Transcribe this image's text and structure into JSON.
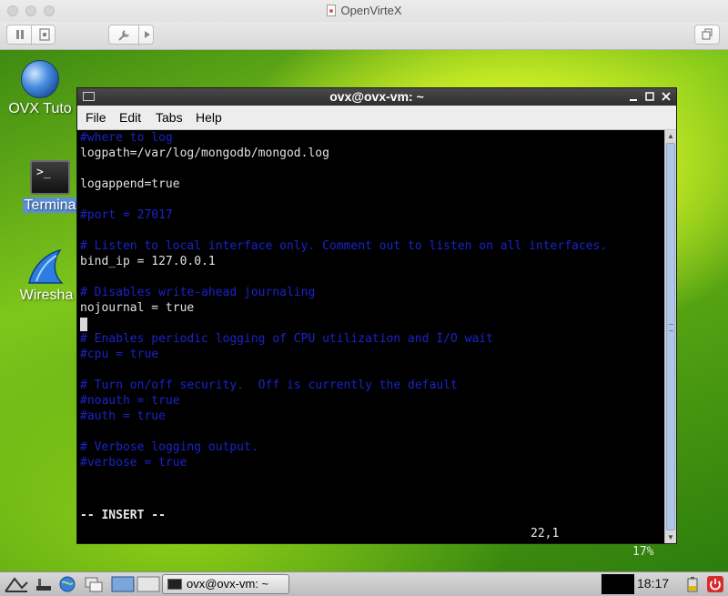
{
  "host_window": {
    "title": "OpenVirteX",
    "toolbar": {
      "buttons": [
        "pause-icon",
        "snapshot-icon",
        "wrench-icon",
        "play-icon",
        "window-icon"
      ]
    }
  },
  "desktop": {
    "icons": [
      {
        "label": "OVX Tuto",
        "icon": "globe-icon",
        "selected": false
      },
      {
        "label": "Termina",
        "icon": "terminal-icon",
        "selected": true
      },
      {
        "label": "Wiresha",
        "icon": "wireshark-icon",
        "selected": false
      }
    ]
  },
  "terminal": {
    "title": "ovx@ovx-vm: ~",
    "menu": [
      "File",
      "Edit",
      "Tabs",
      "Help"
    ],
    "lines": [
      {
        "text": "#where to log",
        "type": "comment"
      },
      {
        "text": "logpath=/var/log/mongodb/mongod.log",
        "type": "text"
      },
      {
        "text": "",
        "type": "text"
      },
      {
        "text": "logappend=true",
        "type": "text"
      },
      {
        "text": "",
        "type": "text"
      },
      {
        "text": "#port = 27017",
        "type": "comment"
      },
      {
        "text": "",
        "type": "text"
      },
      {
        "text": "# Listen to local interface only. Comment out to listen on all interfaces.",
        "type": "comment"
      },
      {
        "text": "bind_ip = 127.0.0.1",
        "type": "text"
      },
      {
        "text": "",
        "type": "text"
      },
      {
        "text": "# Disables write-ahead journaling",
        "type": "comment"
      },
      {
        "text": "nojournal = true",
        "type": "text"
      },
      {
        "text": "",
        "type": "text"
      },
      {
        "text": "# Enables periodic logging of CPU utilization and I/O wait",
        "type": "comment"
      },
      {
        "text": "#cpu = true",
        "type": "comment"
      },
      {
        "text": "",
        "type": "text"
      },
      {
        "text": "# Turn on/off security.  Off is currently the default",
        "type": "comment"
      },
      {
        "text": "#noauth = true",
        "type": "comment"
      },
      {
        "text": "#auth = true",
        "type": "comment"
      },
      {
        "text": "",
        "type": "text"
      },
      {
        "text": "# Verbose logging output.",
        "type": "comment"
      },
      {
        "text": "#verbose = true",
        "type": "comment"
      }
    ],
    "status": {
      "mode": "-- INSERT --",
      "position": "22,1",
      "percent": "17%"
    },
    "colors": {
      "comment": "#1b23c9",
      "text": "#e0e0e0",
      "background": "#000000"
    }
  },
  "taskbar": {
    "task_label": "ovx@ovx-vm: ~",
    "clock": "18:17"
  }
}
